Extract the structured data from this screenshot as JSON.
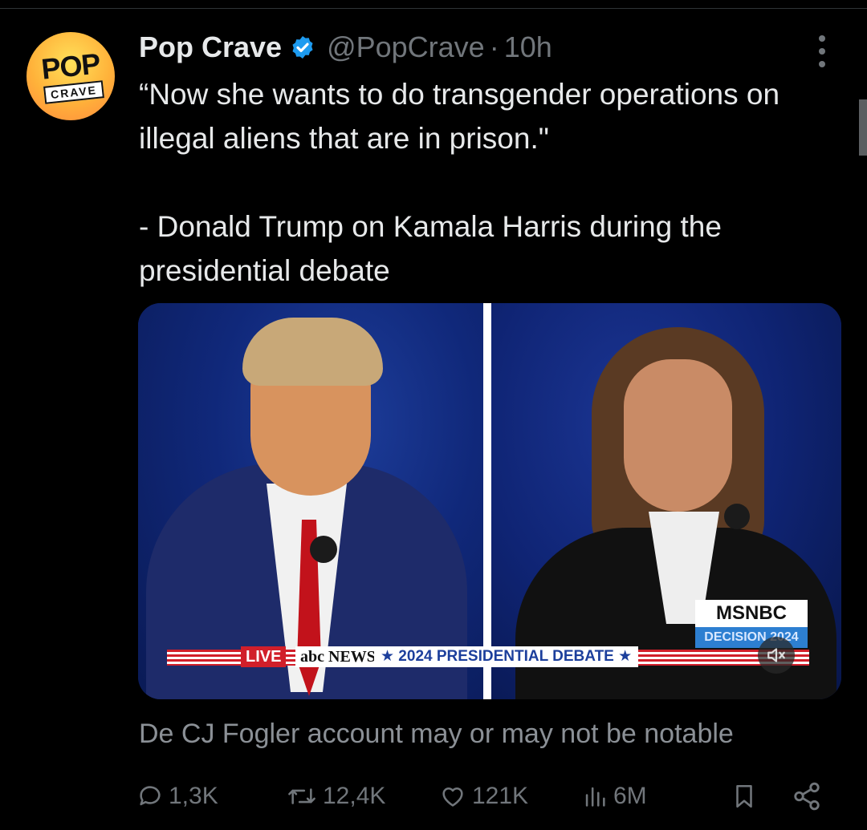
{
  "tweet": {
    "display_name": "Pop Crave",
    "handle": "@PopCrave",
    "separator": "·",
    "time": "10h",
    "text": "“Now she wants to do transgender operations on illegal aliens that are in prison.\"\n\n- Donald Trump on Kamala Harris during the presidential debate",
    "avatar": {
      "line1": "POP",
      "line2": "CRAVE"
    }
  },
  "media": {
    "ticker": {
      "live": "LIVE",
      "network": "NEWS",
      "debate": "★ 2024 PRESIDENTIAL DEBATE ★"
    },
    "bug": {
      "network": "MSNBC",
      "tag": "DECISION 2024"
    }
  },
  "notice": "De CJ Fogler account may or may not be notable",
  "actions": {
    "replies": "1,3K",
    "reposts": "12,4K",
    "likes": "121K",
    "views": "6M"
  },
  "colors": {
    "background": "#000000",
    "text": "#e7e9ea",
    "muted": "#71767b",
    "verified": "#1d9bf0"
  }
}
